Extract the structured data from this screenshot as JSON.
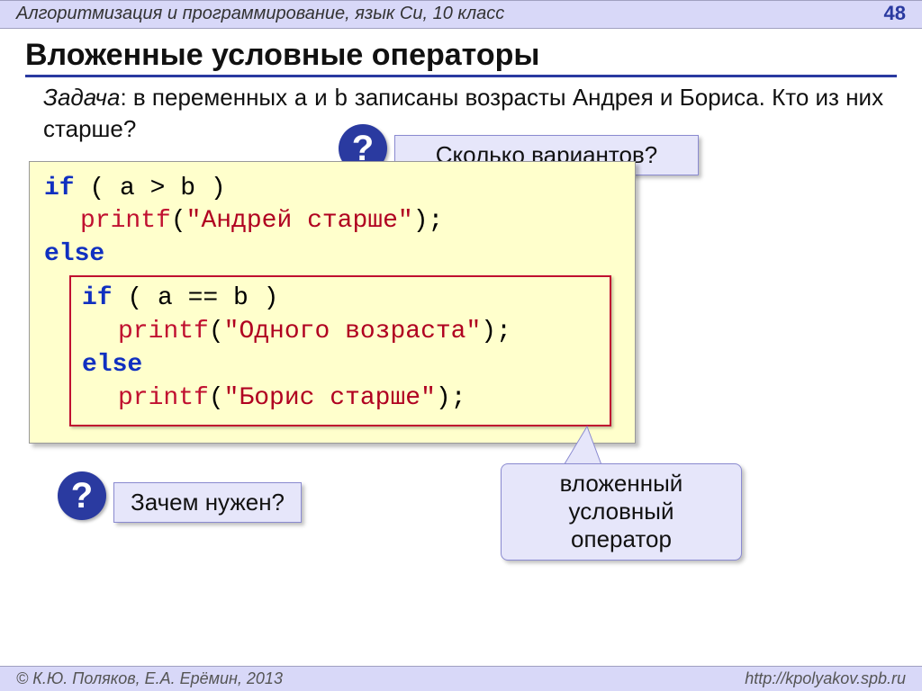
{
  "header": {
    "course": "Алгоритмизация и программирование, язык Си, 10 класс",
    "page_number": "48"
  },
  "title": "Вложенные условные операторы",
  "task": {
    "label": "Задача",
    "text_before_a": ": в переменных ",
    "var_a": "a",
    "text_between": " и ",
    "var_b": "b",
    "text_after_b": " записаны возрасты Андрея и Бориса. Кто из них старше?"
  },
  "callouts": {
    "q1": "Сколько вариантов?",
    "q2": "Зачем нужен?",
    "note_line1": "вложенный",
    "note_line2": "условный",
    "note_line3": "оператор",
    "qmark": "?"
  },
  "code_outer": {
    "l1_kw": "if",
    "l1_rest": " ( a > b )",
    "l2_fn": "printf",
    "l2_str": "\"Андрей старше\"",
    "l2_tail": ");",
    "l2_open": "(",
    "l3_kw": "else"
  },
  "code_inner": {
    "l1_kw": "if",
    "l1_rest": " ( a == b )",
    "l2_fn": "printf",
    "l2_open": "(",
    "l2_str": "\"Одного возраста\"",
    "l2_tail": ");",
    "l3_kw": "else",
    "l4_fn": "printf",
    "l4_open": "(",
    "l4_str": "\"Борис старше\"",
    "l4_tail": ");"
  },
  "footer": {
    "copyright": "© К.Ю. Поляков, Е.А. Ерёмин, 2013",
    "url": "http://kpolyakov.spb.ru"
  }
}
